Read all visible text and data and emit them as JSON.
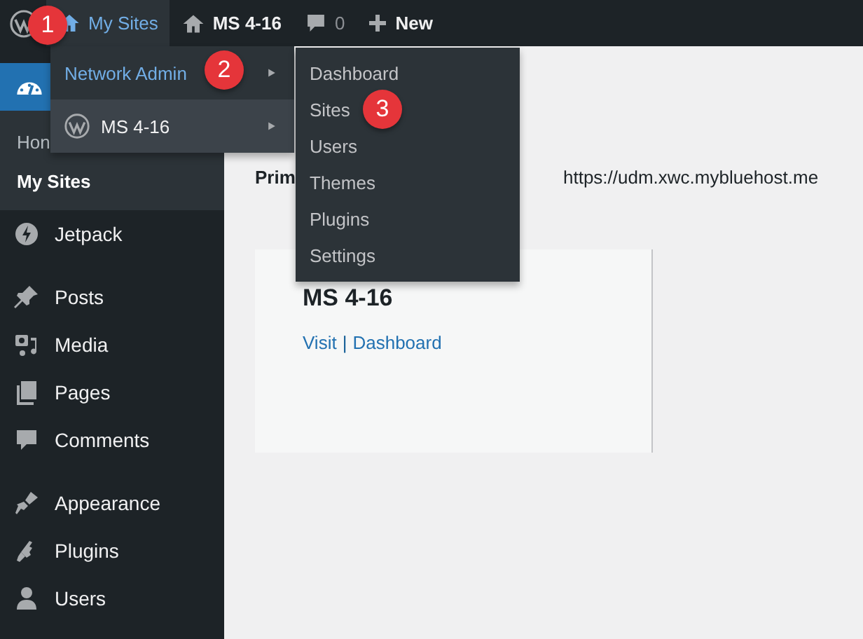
{
  "admin_bar": {
    "my_sites": {
      "label": "My Sites",
      "badge": "1"
    },
    "site": "MS 4-16",
    "comments": "0",
    "new": "New"
  },
  "dropdown": [
    {
      "label": "Network Admin",
      "selected": true,
      "badge": "2"
    },
    {
      "label": "MS 4-16",
      "selected": false
    }
  ],
  "submenu": [
    {
      "label": "Dashboard"
    },
    {
      "label": "Sites",
      "badge": "3"
    },
    {
      "label": "Users"
    },
    {
      "label": "Themes"
    },
    {
      "label": "Plugins"
    },
    {
      "label": "Settings"
    }
  ],
  "sidebar": {
    "sub_items": [
      {
        "label": "Hon",
        "selected": false
      },
      {
        "label": "My Sites",
        "selected": true
      }
    ],
    "groups": [
      [
        "Jetpack"
      ],
      [
        "Posts",
        "Media",
        "Pages",
        "Comments"
      ],
      [
        "Appearance",
        "Plugins",
        "Users"
      ]
    ]
  },
  "primary_site": {
    "label": "Prim",
    "url": "https://udm.xwc.mybluehost.me"
  },
  "site_card": {
    "title": "MS 4-16",
    "links": [
      {
        "kind": "link",
        "text": "Visit"
      },
      {
        "kind": "divider",
        "text": "|"
      },
      {
        "kind": "link",
        "text": "Dashboard"
      }
    ]
  }
}
